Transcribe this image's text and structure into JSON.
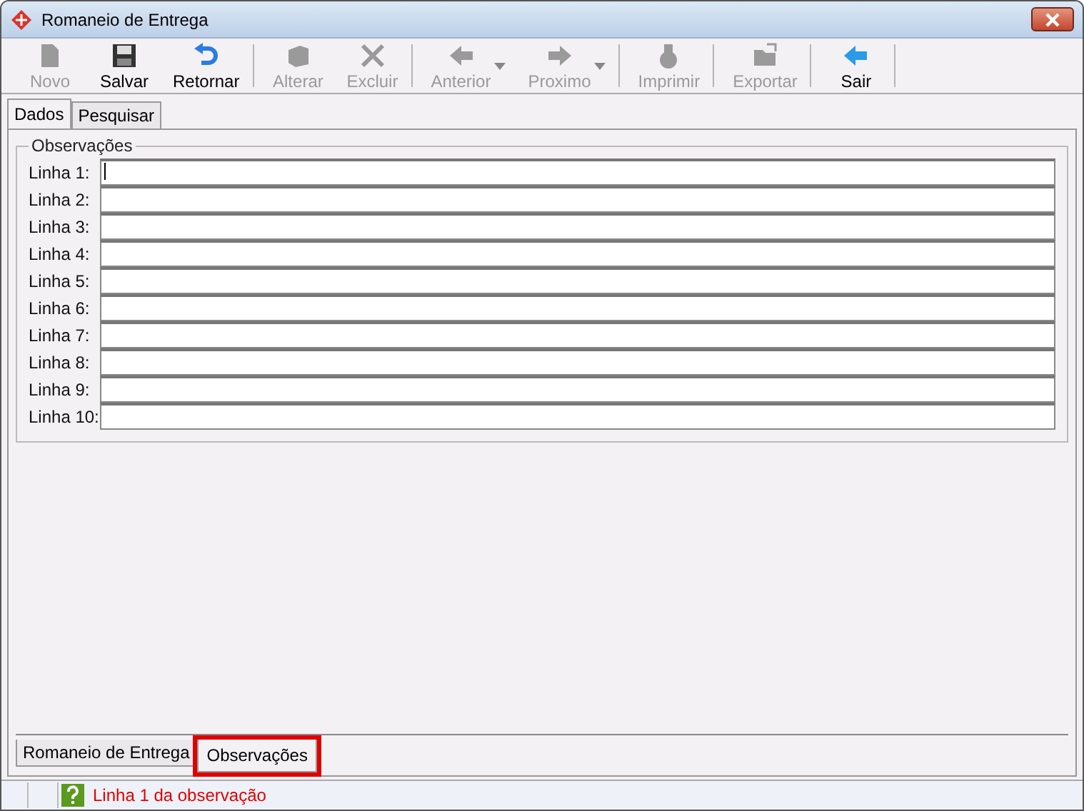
{
  "window": {
    "title": "Romaneio de Entrega"
  },
  "toolbar": [
    {
      "label": "Novo",
      "kind": "new",
      "enabled": false,
      "dropdown": false
    },
    {
      "label": "Salvar",
      "kind": "save",
      "enabled": true,
      "dropdown": false
    },
    {
      "label": "Retornar",
      "kind": "undo",
      "enabled": true,
      "dropdown": false
    },
    {
      "label": "Alterar",
      "kind": "edit",
      "enabled": false,
      "dropdown": false
    },
    {
      "label": "Excluir",
      "kind": "delete",
      "enabled": false,
      "dropdown": false
    },
    {
      "label": "Anterior",
      "kind": "back",
      "enabled": false,
      "dropdown": true
    },
    {
      "label": "Proximo",
      "kind": "forward",
      "enabled": false,
      "dropdown": true
    },
    {
      "label": "Imprimir",
      "kind": "print",
      "enabled": false,
      "dropdown": false
    },
    {
      "label": "Exportar",
      "kind": "export",
      "enabled": false,
      "dropdown": false
    },
    {
      "label": "Sair",
      "kind": "exit",
      "enabled": true,
      "dropdown": false
    }
  ],
  "top_tabs": [
    {
      "label": "Dados",
      "selected": true
    },
    {
      "label": "Pesquisar",
      "selected": false
    }
  ],
  "group": {
    "title": "Observações",
    "lines": [
      {
        "label": "Linha 1:",
        "focused": true
      },
      {
        "label": "Linha 2:",
        "focused": false
      },
      {
        "label": "Linha 3:",
        "focused": false
      },
      {
        "label": "Linha 4:",
        "focused": false
      },
      {
        "label": "Linha 5:",
        "focused": false
      },
      {
        "label": "Linha 6:",
        "focused": false
      },
      {
        "label": "Linha 7:",
        "focused": false
      },
      {
        "label": "Linha 8:",
        "focused": false
      },
      {
        "label": "Linha 9:",
        "focused": false
      },
      {
        "label": "Linha 10:",
        "focused": false
      }
    ]
  },
  "bottom_tabs": [
    {
      "label": "Romaneio de Entrega",
      "selected": false,
      "highlighted": false
    },
    {
      "label": "Observações",
      "selected": true,
      "highlighted": true
    }
  ],
  "status_bar": {
    "message": "Linha 1 da observação"
  }
}
